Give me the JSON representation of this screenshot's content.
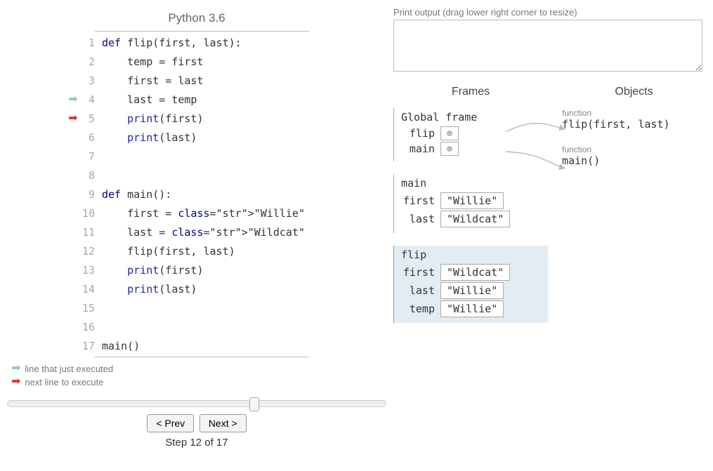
{
  "lang": "Python 3.6",
  "code_lines": [
    "def flip(first, last):",
    "    temp = first",
    "    first = last",
    "    last = temp",
    "    print(first)",
    "    print(last)",
    "",
    "",
    "def main():",
    "    first = \"Willie\"",
    "    last = \"Wildcat\"",
    "    flip(first, last)",
    "    print(first)",
    "    print(last)",
    "",
    "",
    "main()"
  ],
  "prev_line": 4,
  "next_line": 5,
  "legend": {
    "prev": "line that just executed",
    "next": "next line to execute"
  },
  "nav": {
    "prev_label": "< Prev",
    "next_label": "Next >"
  },
  "step": {
    "current": 12,
    "total": 17,
    "text": "Step 12 of 17"
  },
  "slider_percent": 64,
  "output": {
    "label": "Print output (drag lower right corner to resize)",
    "text": ""
  },
  "viz": {
    "frames_heading": "Frames",
    "objects_heading": "Objects",
    "global_frame": {
      "title": "Global frame",
      "vars": [
        {
          "name": "flip",
          "ref": 0
        },
        {
          "name": "main",
          "ref": 1
        }
      ]
    },
    "frames": [
      {
        "name": "main",
        "highlighted": false,
        "vars": [
          {
            "name": "first",
            "value": "\"Willie\""
          },
          {
            "name": "last",
            "value": "\"Wildcat\""
          }
        ]
      },
      {
        "name": "flip",
        "highlighted": true,
        "vars": [
          {
            "name": "first",
            "value": "\"Wildcat\""
          },
          {
            "name": "last",
            "value": "\"Willie\""
          },
          {
            "name": "temp",
            "value": "\"Willie\""
          }
        ]
      }
    ],
    "objects": [
      {
        "type": "function",
        "repr": "flip(first, last)"
      },
      {
        "type": "function",
        "repr": "main()"
      }
    ]
  }
}
